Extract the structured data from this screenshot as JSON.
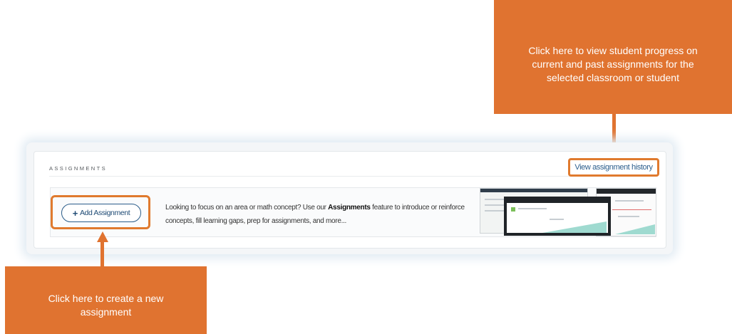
{
  "assignments": {
    "section_title": "ASSIGNMENTS",
    "history_link": "View assignment history",
    "add_button": "Add Assignment",
    "add_icon": "plus-icon",
    "promo_text_before": "Looking to focus on an area or math concept? Use our ",
    "promo_text_bold": "Assignments",
    "promo_text_after": " feature to introduce or reinforce concepts, fill learning gaps, prep for assignments, and more..."
  },
  "callouts": {
    "history": "Click here to view student progress on current and past assignments for the selected classroom or student",
    "create": "Click here to create a new assignment"
  },
  "colors": {
    "callout": "#e07330",
    "highlight": "#e07a2e",
    "link": "#2d5f8d"
  }
}
